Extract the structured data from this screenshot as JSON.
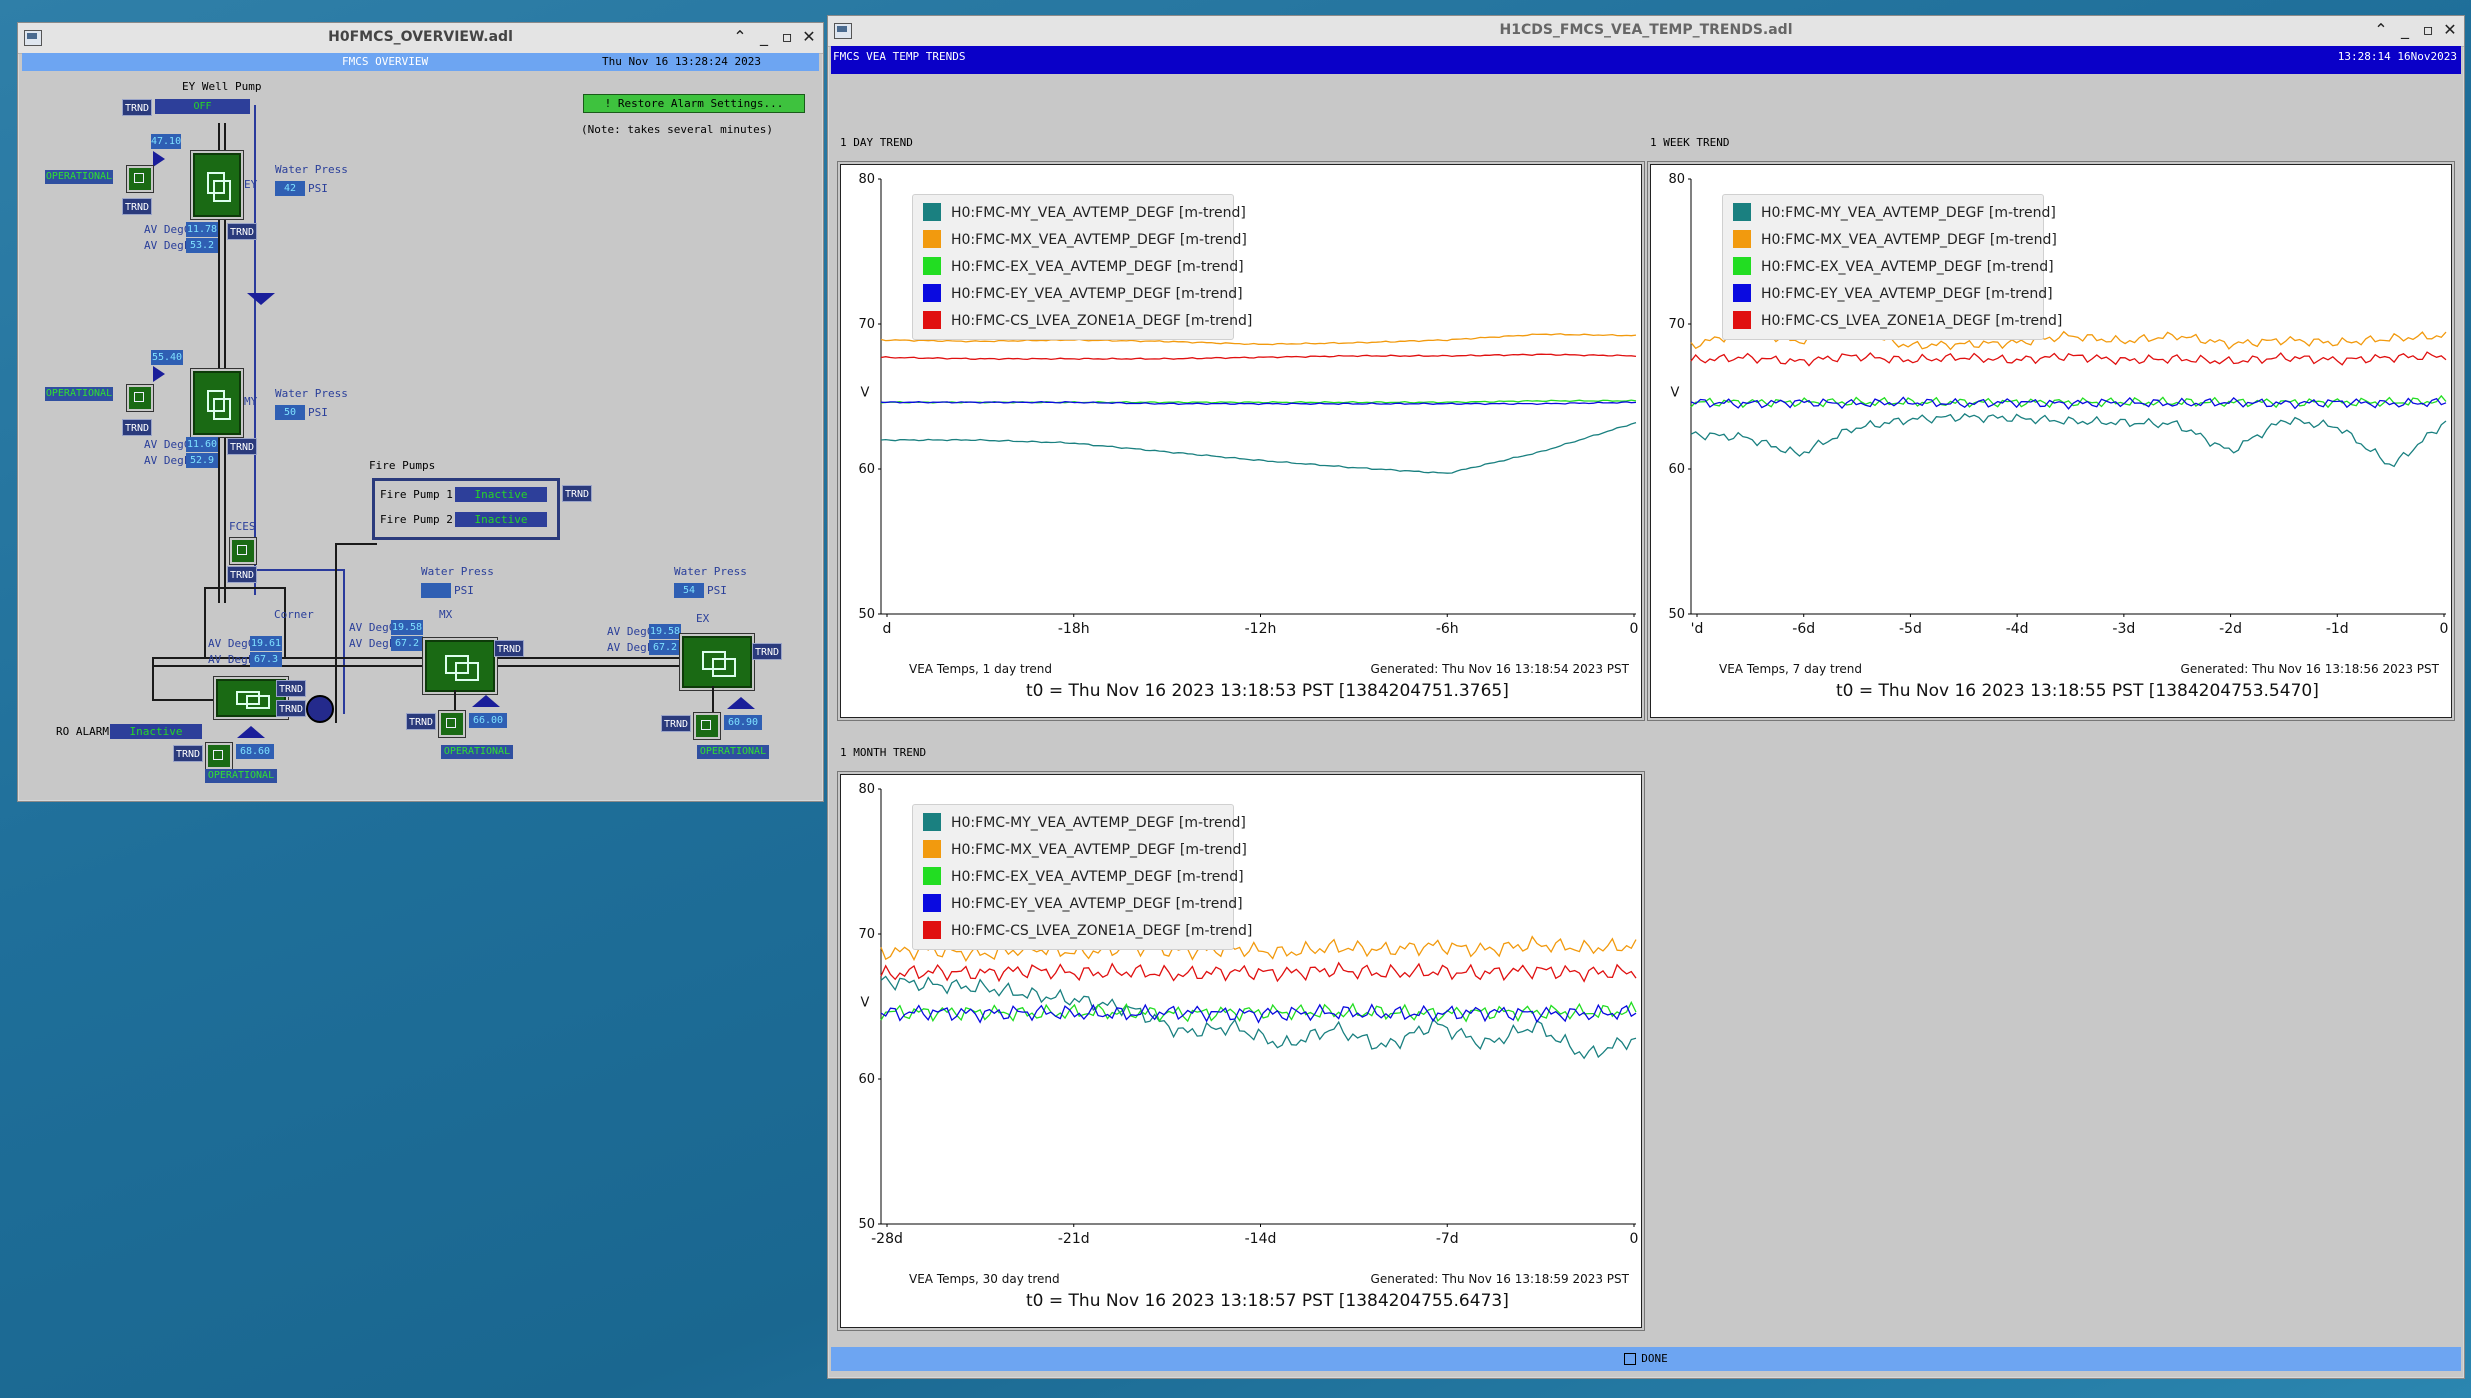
{
  "overview": {
    "window_title": "H0FMCS_OVERVIEW.adl",
    "header": "FMCS OVERVIEW",
    "datetime": "Thu Nov 16 13:28:24 2023",
    "restore_button": "! Restore Alarm Settings...",
    "restore_note": "(Note: takes several minutes)",
    "ey_well_pump_label": "EY Well Pump",
    "ey_well_pump_value": "OFF",
    "trnd": "TRND",
    "operational": "OPERATIONAL",
    "water_press_label": "Water Press",
    "psi": "PSI",
    "av_degc": "AV DegC",
    "av_degf": "AV DegF",
    "ey": {
      "label": "EY",
      "top_value": "47.10",
      "press": "42",
      "degc": "11.78",
      "degf": "53.2"
    },
    "my": {
      "label": "MY",
      "top_value": "55.40",
      "press": "50",
      "degc": "11.60",
      "degf": "52.9"
    },
    "fces_label": "FCES",
    "corner": {
      "label": "Corner",
      "degc": "19.61",
      "degf": "67.3",
      "bottom_value": "68.60"
    },
    "mx": {
      "label": "MX",
      "press": "",
      "degc": "19.58",
      "degf": "67.2",
      "bottom_value": "66.00"
    },
    "ex": {
      "label": "EX",
      "press": "54",
      "degc": "19.58",
      "degf": "67.2",
      "bottom_value": "60.90"
    },
    "fire_pumps": {
      "title": "Fire Pumps",
      "pump1_label": "Fire Pump 1",
      "pump1_status": "Inactive",
      "pump2_label": "Fire Pump 2",
      "pump2_status": "Inactive"
    },
    "ro_alarm_label": "RO ALARM",
    "ro_alarm_status": "Inactive"
  },
  "trends": {
    "window_title": "H1CDS_FMCS_VEA_TEMP_TRENDS.adl",
    "header": "FMCS VEA TEMP TRENDS",
    "datetime": "13:28:14 16Nov2023",
    "done_label": "DONE",
    "legend": [
      {
        "name": "H0:FMC-MY_VEA_AVTEMP_DEGF [m-trend]",
        "color": "#1a8080"
      },
      {
        "name": "H0:FMC-MX_VEA_AVTEMP_DEGF [m-trend]",
        "color": "#f29a0e"
      },
      {
        "name": "H0:FMC-EX_VEA_AVTEMP_DEGF [m-trend]",
        "color": "#22dd22"
      },
      {
        "name": "H0:FMC-EY_VEA_AVTEMP_DEGF [m-trend]",
        "color": "#0a0ae0"
      },
      {
        "name": "H0:FMC-CS_LVEA_ZONE1A_DEGF [m-trend]",
        "color": "#e01010"
      }
    ],
    "y_axis_label": "V",
    "y_ticks": [
      "80",
      "70",
      "60",
      "50"
    ],
    "day": {
      "section_label": "1 DAY TREND",
      "x_ticks": [
        "d",
        "-18h",
        "-12h",
        "-6h",
        "0"
      ],
      "footer_left": "VEA Temps, 1 day trend",
      "footer_right": "Generated: Thu Nov 16 13:18:54 2023 PST",
      "t0": "t0 = Thu Nov 16 2023 13:18:53 PST [1384204751.3765]"
    },
    "week": {
      "section_label": "1 WEEK TREND",
      "x_ticks": [
        "'d",
        "-6d",
        "-5d",
        "-4d",
        "-3d",
        "-2d",
        "-1d",
        "0"
      ],
      "footer_left": "VEA Temps, 7 day trend",
      "footer_right": "Generated: Thu Nov 16 13:18:56 2023 PST",
      "t0": "t0 = Thu Nov 16 2023 13:18:55 PST [1384204753.5470]"
    },
    "month": {
      "section_label": "1 MONTH TREND",
      "x_ticks": [
        "-28d",
        "-21d",
        "-14d",
        "-7d",
        "0"
      ],
      "footer_left": "VEA Temps, 30 day trend",
      "footer_right": "Generated: Thu Nov 16 13:18:59 2023 PST",
      "t0": "t0 = Thu Nov 16 2023 13:18:57 PST [1384204755.6473]"
    }
  },
  "chart_data": [
    {
      "type": "line",
      "title": "VEA Temps, 1 day trend",
      "x": [
        -24,
        -21,
        -18,
        -15,
        -12,
        -9,
        -6,
        -3,
        0
      ],
      "x_unit": "hours",
      "ylim": [
        50,
        80
      ],
      "series": [
        {
          "name": "H0:FMC-MY_VEA_AVTEMP_DEGF [m-trend]",
          "color": "#1a8080",
          "values": [
            62.0,
            62.0,
            61.8,
            61.2,
            60.6,
            60.1,
            59.7,
            61.2,
            63.2
          ]
        },
        {
          "name": "H0:FMC-MX_VEA_AVTEMP_DEGF [m-trend]",
          "color": "#f29a0e",
          "values": [
            68.9,
            68.8,
            68.9,
            68.8,
            68.6,
            68.7,
            68.9,
            69.3,
            69.2
          ]
        },
        {
          "name": "H0:FMC-EX_VEA_AVTEMP_DEGF [m-trend]",
          "color": "#22dd22",
          "values": [
            64.6,
            64.6,
            64.6,
            64.6,
            64.6,
            64.6,
            64.6,
            64.7,
            64.7
          ]
        },
        {
          "name": "H0:FMC-EY_VEA_AVTEMP_DEGF [m-trend]",
          "color": "#0a0ae0",
          "values": [
            64.6,
            64.6,
            64.6,
            64.5,
            64.5,
            64.5,
            64.5,
            64.5,
            64.6
          ]
        },
        {
          "name": "H0:FMC-CS_LVEA_ZONE1A_DEGF [m-trend]",
          "color": "#e01010",
          "values": [
            67.7,
            67.6,
            67.6,
            67.6,
            67.7,
            67.8,
            67.8,
            67.9,
            67.8
          ]
        }
      ]
    },
    {
      "type": "line",
      "title": "VEA Temps, 7 day trend",
      "x": [
        -7,
        -6.5,
        -6,
        -5.5,
        -5,
        -4.5,
        -4,
        -3.5,
        -3,
        -2.5,
        -2,
        -1.5,
        -1,
        -0.5,
        0
      ],
      "x_unit": "days",
      "ylim": [
        50,
        80
      ],
      "series": [
        {
          "name": "H0:FMC-MY_VEA_AVTEMP_DEGF [m-trend]",
          "color": "#1a8080",
          "values": [
            62.4,
            62.2,
            61.0,
            62.8,
            63.4,
            63.6,
            63.5,
            63.3,
            63.2,
            63.1,
            61.2,
            63.4,
            62.9,
            60.2,
            63.3
          ]
        },
        {
          "name": "H0:FMC-MX_VEA_AVTEMP_DEGF [m-trend]",
          "color": "#f29a0e",
          "values": [
            68.5,
            69.5,
            68.8,
            69.6,
            68.5,
            68.6,
            68.7,
            69.2,
            68.8,
            69.2,
            68.6,
            68.9,
            68.7,
            69.0,
            69.2
          ]
        },
        {
          "name": "H0:FMC-EX_VEA_AVTEMP_DEGF [m-trend]",
          "color": "#22dd22",
          "values": [
            64.6,
            64.6,
            64.6,
            64.6,
            64.6,
            64.6,
            64.6,
            64.6,
            64.6,
            64.6,
            64.6,
            64.6,
            64.6,
            64.6,
            64.7
          ]
        },
        {
          "name": "H0:FMC-EY_VEA_AVTEMP_DEGF [m-trend]",
          "color": "#0a0ae0",
          "values": [
            64.6,
            64.5,
            64.6,
            64.5,
            64.6,
            64.5,
            64.6,
            64.5,
            64.6,
            64.5,
            64.6,
            64.5,
            64.6,
            64.5,
            64.6
          ]
        },
        {
          "name": "H0:FMC-CS_LVEA_ZONE1A_DEGF [m-trend]",
          "color": "#e01010",
          "values": [
            67.5,
            67.7,
            67.4,
            67.8,
            67.5,
            67.7,
            67.5,
            67.8,
            67.5,
            67.6,
            67.4,
            67.7,
            67.5,
            67.7,
            67.8
          ]
        }
      ]
    },
    {
      "type": "line",
      "title": "VEA Temps, 30 day trend",
      "x": [
        -30,
        -28,
        -26,
        -24,
        -22,
        -20,
        -18,
        -16,
        -14,
        -12,
        -10,
        -8,
        -6,
        -4,
        -2,
        0
      ],
      "x_unit": "days",
      "ylim": [
        50,
        80
      ],
      "series": [
        {
          "name": "H0:FMC-MY_VEA_AVTEMP_DEGF [m-trend]",
          "color": "#1a8080",
          "values": [
            66.8,
            66.5,
            66.3,
            65.8,
            65.4,
            64.8,
            63.2,
            63.6,
            62.3,
            63.5,
            62.2,
            63.8,
            62.4,
            63.7,
            61.6,
            62.8
          ]
        },
        {
          "name": "H0:FMC-MX_VEA_AVTEMP_DEGF [m-trend]",
          "color": "#f29a0e",
          "values": [
            68.7,
            68.9,
            68.6,
            69.0,
            68.7,
            69.1,
            68.8,
            69.0,
            68.7,
            69.1,
            68.9,
            69.2,
            68.9,
            69.3,
            69.0,
            69.2
          ]
        },
        {
          "name": "H0:FMC-EX_VEA_AVTEMP_DEGF [m-trend]",
          "color": "#22dd22",
          "values": [
            64.6,
            64.6,
            64.6,
            64.5,
            64.6,
            64.6,
            64.5,
            64.6,
            64.6,
            64.6,
            64.6,
            64.5,
            64.6,
            64.6,
            64.6,
            64.7
          ]
        },
        {
          "name": "H0:FMC-EY_VEA_AVTEMP_DEGF [m-trend]",
          "color": "#0a0ae0",
          "values": [
            64.5,
            64.6,
            64.5,
            64.6,
            64.5,
            64.5,
            64.6,
            64.5,
            64.5,
            64.6,
            64.5,
            64.5,
            64.6,
            64.5,
            64.5,
            64.6
          ]
        },
        {
          "name": "H0:FMC-CS_LVEA_ZONE1A_DEGF [m-trend]",
          "color": "#e01010",
          "values": [
            67.2,
            67.4,
            67.3,
            67.5,
            67.3,
            67.4,
            67.2,
            67.4,
            67.3,
            67.5,
            67.3,
            67.4,
            67.3,
            67.5,
            67.3,
            67.4
          ]
        }
      ]
    }
  ]
}
